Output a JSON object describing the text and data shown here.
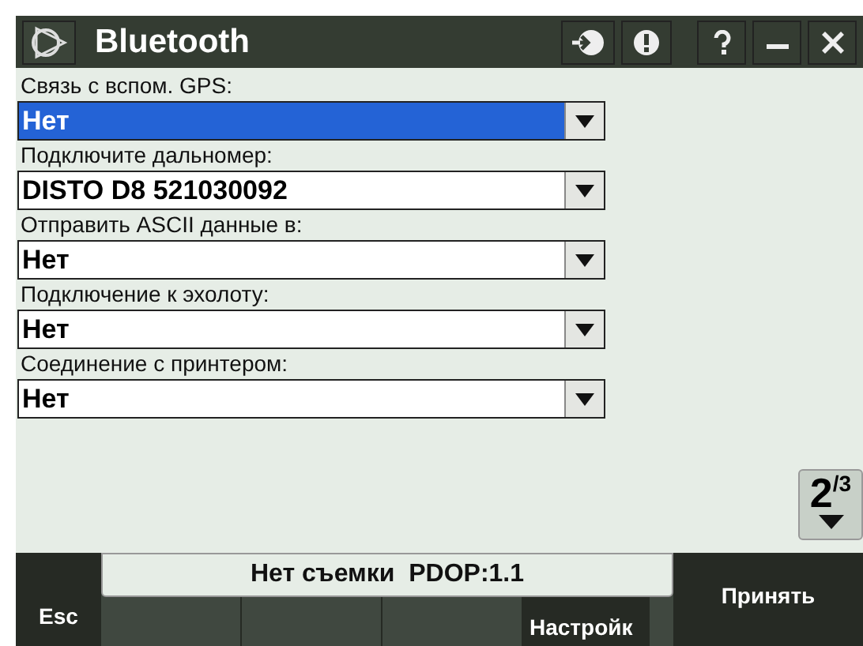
{
  "window": {
    "title": "Bluetooth"
  },
  "fields": [
    {
      "label": "Связь с вспом. GPS:",
      "value": "Нет",
      "selected": true
    },
    {
      "label": "Подключите дальномер:",
      "value": "DISTO D8 521030092",
      "selected": false
    },
    {
      "label": "Отправить ASCII данные в:",
      "value": "Нет",
      "selected": false
    },
    {
      "label": "Подключение к эхолоту:",
      "value": "Нет",
      "selected": false
    },
    {
      "label": "Соединение с принтером:",
      "value": "Нет",
      "selected": false
    }
  ],
  "page": {
    "current": "2",
    "total": "/3"
  },
  "status_bar": "Нет съемки  PDOP:1.1",
  "softkeys": {
    "esc": "Esc",
    "settings": "Настройк",
    "accept": "Принять"
  }
}
